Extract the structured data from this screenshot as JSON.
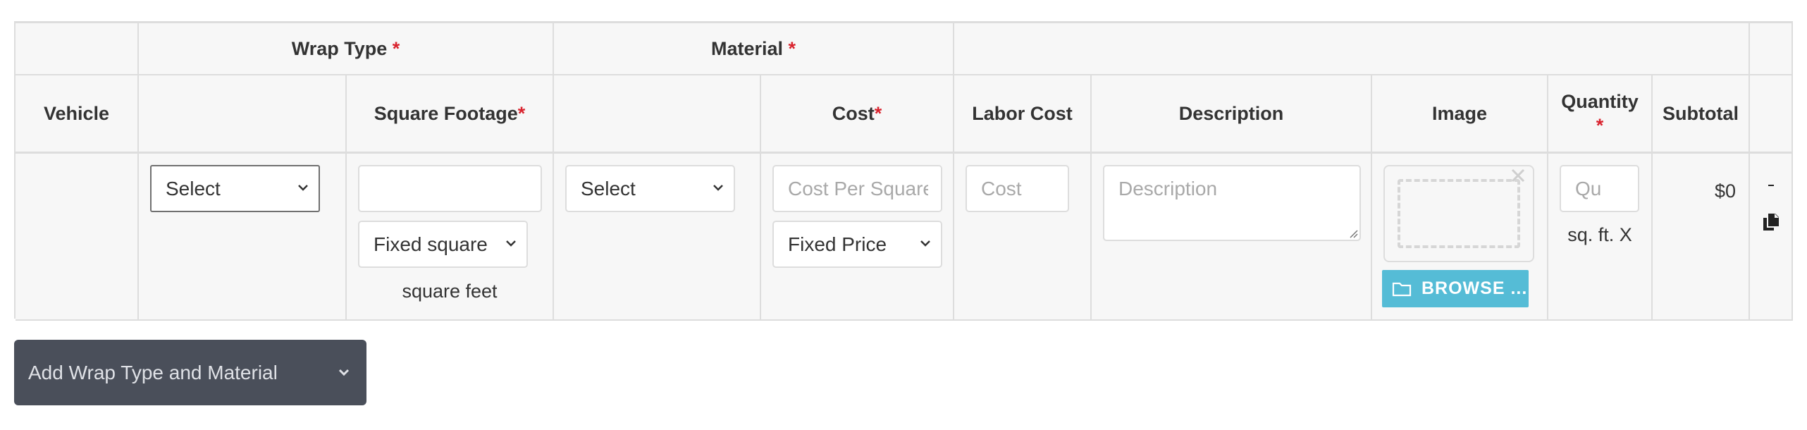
{
  "header": {
    "wrap_type": "Wrap Type",
    "material": "Material",
    "required_mark": "*",
    "vehicle": "Vehicle",
    "square_footage": "Square Footage",
    "cost": "Cost",
    "labor_cost": "Labor Cost",
    "description": "Description",
    "image": "Image",
    "quantity": "Quantity",
    "subtotal": "Subtotal"
  },
  "row": {
    "wrap_type_select": "Select",
    "square_footage_value": "",
    "footage_mode_select": "Fixed square",
    "footage_unit": "square feet",
    "material_select": "Select",
    "cost_per_placeholder": "Cost Per Square",
    "cost_mode_select": "Fixed Price",
    "labor_cost_placeholder": "Cost",
    "description_placeholder": "Description",
    "browse_label": "BROWSE ...",
    "quantity_placeholder": "Qu",
    "quantity_suffix": "sq. ft. X",
    "subtotal_value": "$0"
  },
  "footer": {
    "add_button_label": "Add Wrap Type and Material"
  },
  "colors": {
    "required": "#d9232e",
    "browse_button": "#55bcd6",
    "add_button": "#4a4f5a"
  },
  "icons": {
    "select_arrow": "chevron-down-icon",
    "remove_image": "close-icon",
    "browse": "folder-icon",
    "remove_row": "minus-icon",
    "duplicate_row": "copy-icon",
    "add_button_arrow": "chevron-down-icon"
  }
}
